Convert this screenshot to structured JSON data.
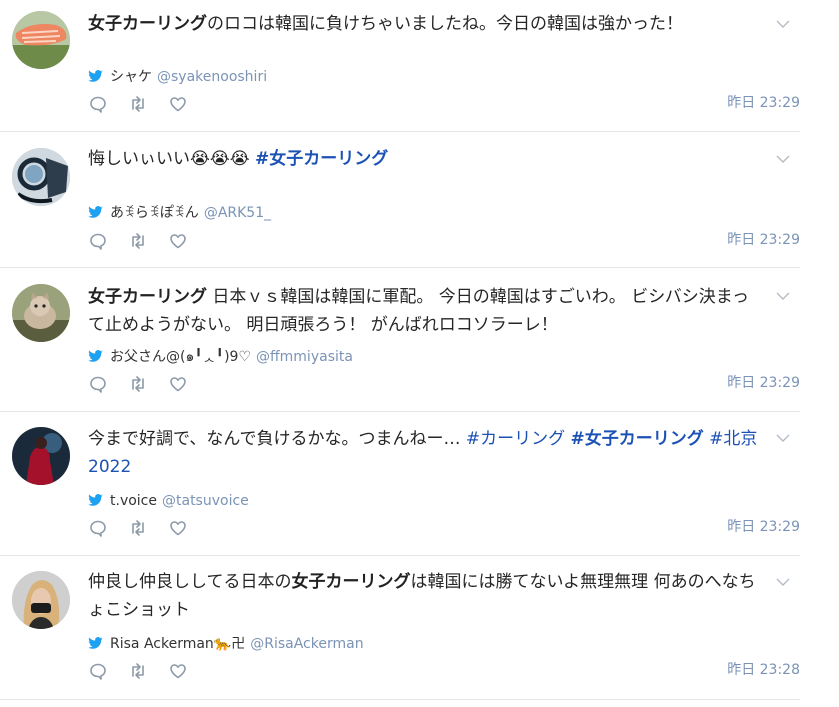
{
  "tweets": [
    {
      "parts": [
        {
          "text": "女子カーリング",
          "style": "kw"
        },
        {
          "text": "のロコは韓国に負けちゃいましたね。今日の韓国は強かった！",
          "style": "plain"
        }
      ],
      "author_name": "シャケ",
      "author_handle": "@syakenooshiri",
      "time": "昨日 23:29",
      "avatar": "salmon-avatar"
    },
    {
      "parts": [
        {
          "text": "悔しいぃいい😭😭😭 ",
          "style": "plain"
        },
        {
          "text": "#女子カーリング",
          "style": "kwtag"
        }
      ],
      "author_name": "あꉂらꉂぽꉂん",
      "author_handle": "@ARK51_",
      "time": "昨日 23:29",
      "avatar": "glass-avatar"
    },
    {
      "parts": [
        {
          "text": "女子カーリング",
          "style": "kw"
        },
        {
          "text": " 日本ｖｓ韓国は韓国に軍配。 今日の韓国はすごいわ。 ビシバシ決まって止めようがない。 明日頑張ろう！ がんばれロコソラーレ！",
          "style": "plain"
        }
      ],
      "author_name": "お父さん@(๑╹ᆺ╹)9♡",
      "author_handle": "@ffmmiyasita",
      "time": "昨日 23:29",
      "avatar": "cat-avatar"
    },
    {
      "parts": [
        {
          "text": "今まで好調で、なんで負けるかな。つまんねー… ",
          "style": "plain"
        },
        {
          "text": "#カーリング",
          "style": "tag"
        },
        {
          "text": " ",
          "style": "plain"
        },
        {
          "text": "#女子カーリング",
          "style": "kwtag"
        },
        {
          "text": " #北京2022",
          "style": "tag"
        }
      ],
      "author_name": "t.voice",
      "author_handle": "@tatsuvoice",
      "time": "昨日 23:29",
      "avatar": "dark-figure-avatar"
    },
    {
      "parts": [
        {
          "text": "仲良し仲良ししてる日本の",
          "style": "plain"
        },
        {
          "text": "女子カーリング",
          "style": "kw"
        },
        {
          "text": "は韓国には勝てないよ無理無理 何あのへなちょこショット",
          "style": "plain"
        }
      ],
      "author_name": "Risa Ackerman🐆卍",
      "author_handle": "@RisaAckerman",
      "time": "昨日 23:28",
      "avatar": "woman-avatar"
    }
  ],
  "icons": {
    "reply": "reply-icon",
    "retweet": "retweet-icon",
    "like": "like-icon",
    "menu": "chevron-down-icon",
    "source": "twitter-bird-icon"
  },
  "colors": {
    "link": "#1d52b5",
    "handle": "#7b93b5",
    "icon": "#8e9aa8",
    "twitter": "#1da1f2",
    "divider": "#e3e6e9"
  }
}
